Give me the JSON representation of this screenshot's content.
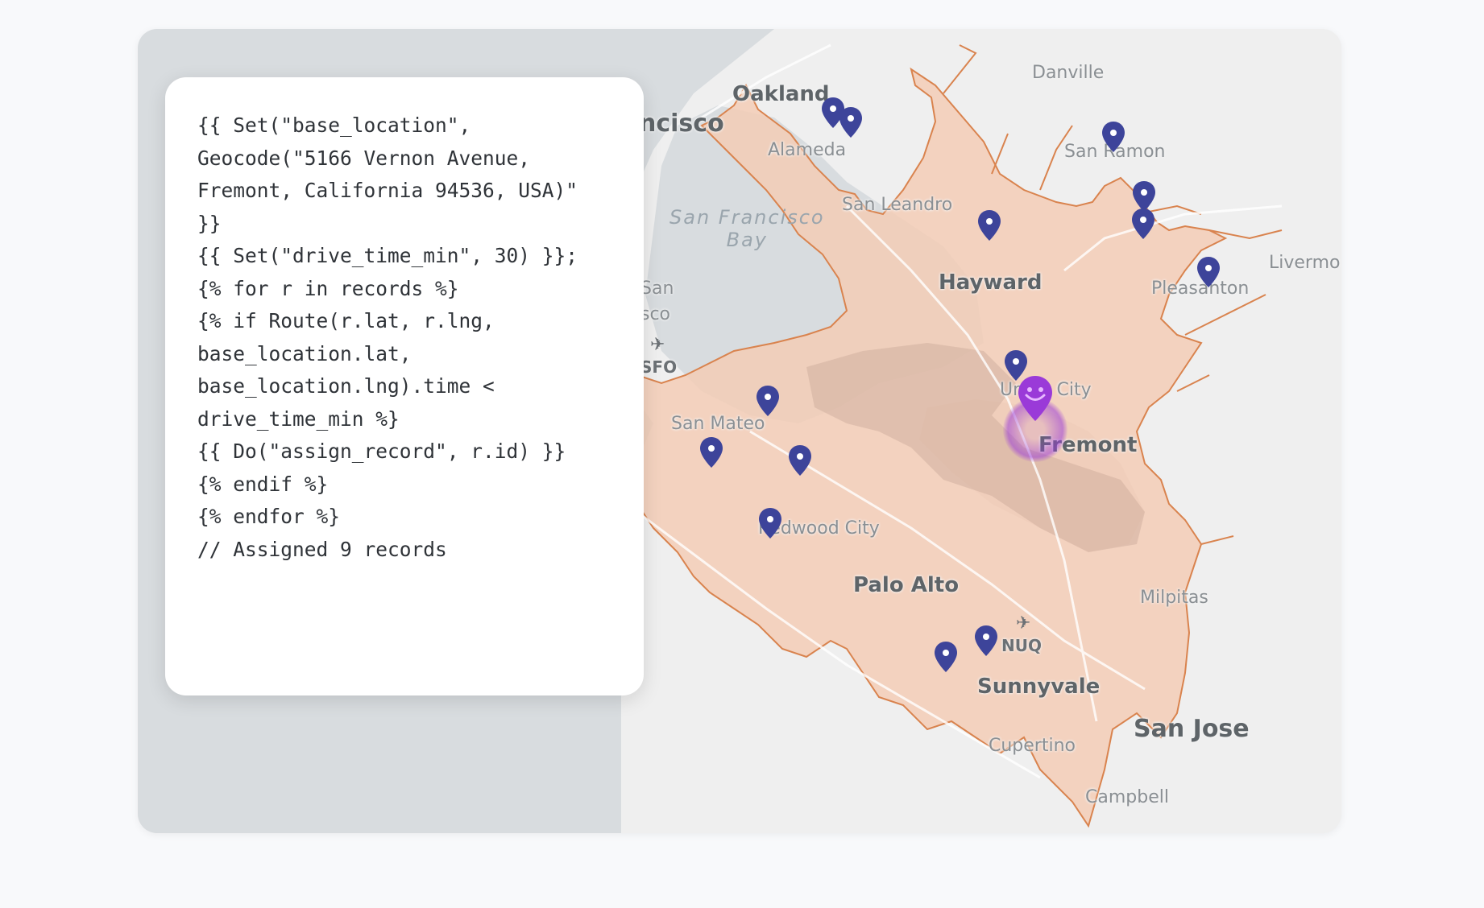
{
  "map": {
    "city_labels": {
      "oakland": "Oakland",
      "francisco": "ncisco",
      "alameda": "Alameda",
      "danville": "Danville",
      "san_ramon": "San Ramon",
      "san_leandro": "San Leandro",
      "hayward": "Hayward",
      "livermore": "Livermo",
      "pleasanton": "Pleasanton",
      "union_city": "Union City",
      "fremont": "Fremont",
      "san_mateo": "San Mateo",
      "redwood_city": "Redwood City",
      "palo_alto": "Palo Alto",
      "milpitas": "Milpitas",
      "sunnyvale": "Sunnyvale",
      "san_jose": "San Jose",
      "cupertino": "Cupertino",
      "campbell": "Campbell",
      "nuq": "NUQ",
      "sfo": "SFO",
      "san_frag": "San",
      "sco_frag": "sco"
    },
    "water_label_line1": "San Francisco",
    "water_label_line2": "Bay",
    "record_pin_count": 15,
    "colors": {
      "land": "#efefef",
      "water": "#d8dcdf",
      "isochrone_fill": "#f3cdb6",
      "isochrone_stroke": "#d9834e",
      "record_pin": "#3d449a",
      "base_pin": "#9a3ad8"
    },
    "icons": {
      "record_marker": "map-pin-icon",
      "base_marker": "smiley-pin-icon",
      "airport": "airplane-icon"
    }
  },
  "code_panel": {
    "lines": [
      "{{ Set(\"base_location\",",
      "Geocode(\"5166 Vernon Avenue,",
      "Fremont, California 94536, USA)\"",
      "}}",
      "",
      "{{ Set(\"drive_time_min\", 30) }};",
      "",
      "{% for r in records %}",
      "{% if Route(r.lat, r.lng,",
      "base_location.lat,",
      "base_location.lng).time <",
      "drive_time_min %}",
      "{{ Do(\"assign_record\", r.id) }}",
      "{% endif %}",
      "{% endfor %}",
      "",
      "// Assigned 9 records"
    ]
  }
}
